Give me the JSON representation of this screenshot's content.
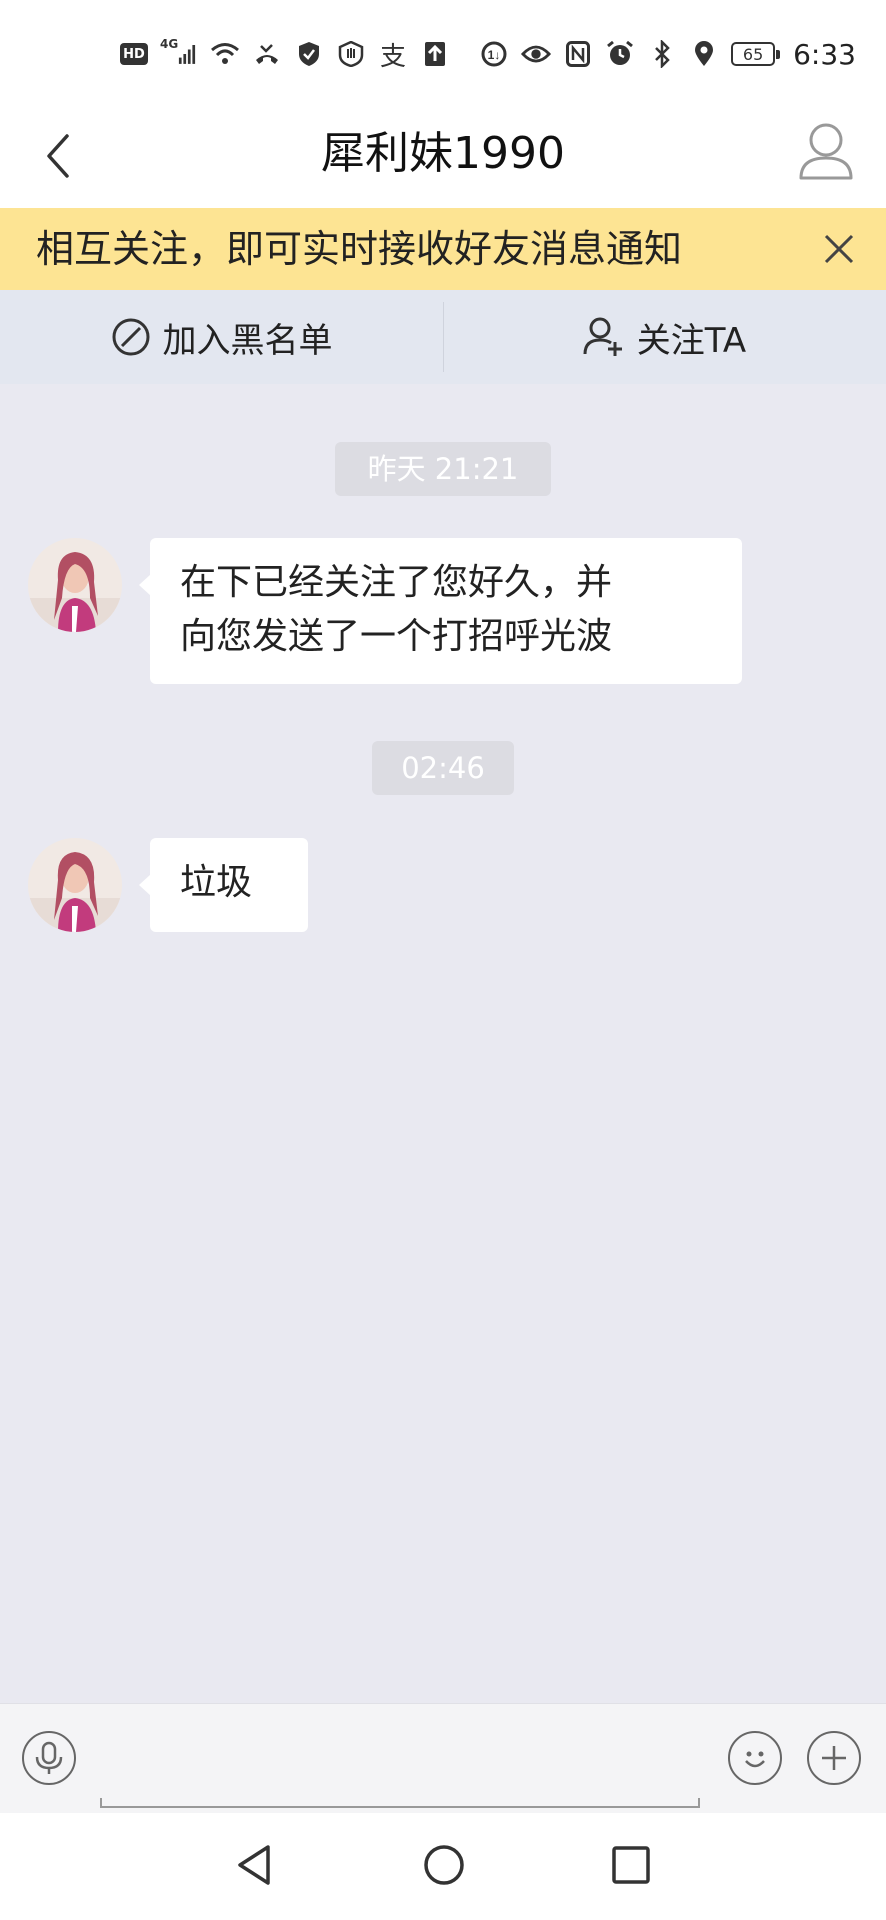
{
  "status_bar": {
    "left_badges": [
      "HD",
      "4G"
    ],
    "alipay_char": "支",
    "battery": "65",
    "time": "6:33"
  },
  "header": {
    "title": "犀利妹1990"
  },
  "notice": {
    "text": "相互关注，即可实时接收好友消息通知"
  },
  "actions": {
    "blacklist_label": "加入黑名单",
    "follow_label": "关注TA"
  },
  "chat": {
    "messages": [
      {
        "time": "昨天 21:21",
        "text_line1": "在下已经关注了您好久，并",
        "text_line2": "向您发送了一个打招呼光波"
      },
      {
        "time": "02:46",
        "text": "垃圾"
      }
    ]
  },
  "colors": {
    "notice_bg": "#fde493",
    "action_bar_bg": "#e3e7f0",
    "chat_bg": "#e9e9f1",
    "bubble_bg": "#ffffff"
  }
}
